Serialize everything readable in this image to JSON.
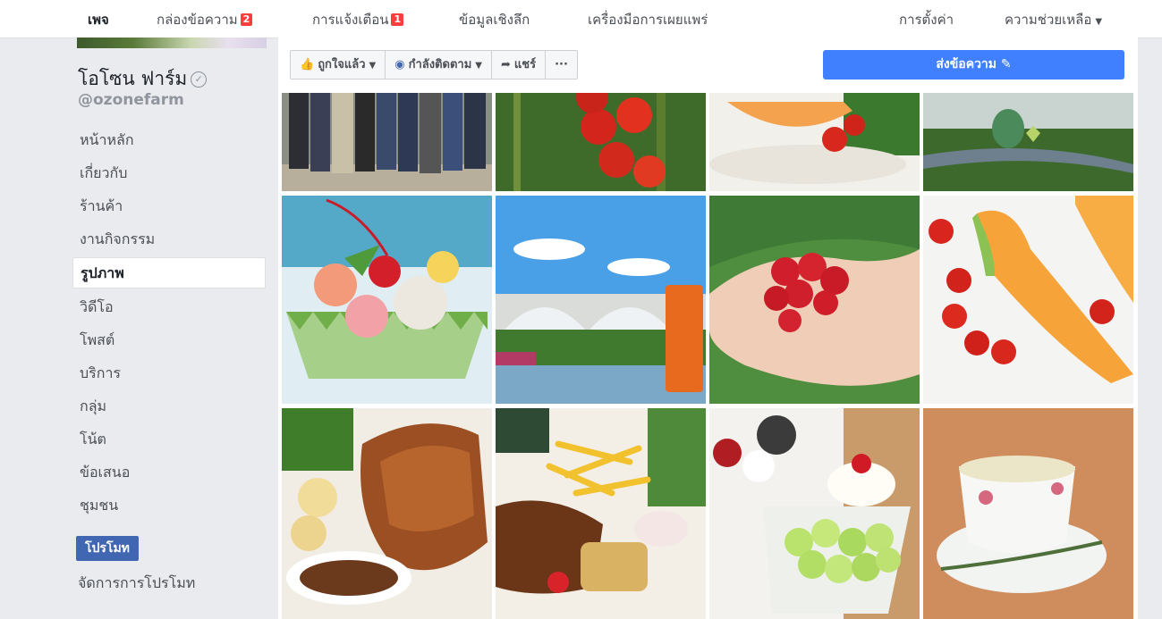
{
  "topnav": {
    "page_tab": "เพจ",
    "inbox_tab": "กล่องข้อความ",
    "inbox_count": "2",
    "notifications_tab": "การแจ้งเตือน",
    "notifications_count": "1",
    "insights_tab": "ข้อมูลเชิงลึก",
    "publishing_tools_tab": "เครื่องมือการเผยแพร่",
    "settings_tab": "การตั้งค่า",
    "help_tab": "ความช่วยเหลือ"
  },
  "page": {
    "name": "โอโซน ฟาร์ม",
    "handle": "@ozonefarm"
  },
  "sidebar": {
    "items": [
      {
        "label": "หน้าหลัก"
      },
      {
        "label": "เกี่ยวกับ"
      },
      {
        "label": "ร้านค้า"
      },
      {
        "label": "งานกิจกรรม"
      },
      {
        "label": "รูปภาพ",
        "selected": true
      },
      {
        "label": "วิดีโอ"
      },
      {
        "label": "โพสต์"
      },
      {
        "label": "บริการ"
      },
      {
        "label": "กลุ่ม"
      },
      {
        "label": "โน้ต"
      },
      {
        "label": "ข้อเสนอ"
      },
      {
        "label": "ชุมชน"
      }
    ],
    "promote_label": "โปรโมท",
    "manage_promotions_label": "จัดการการโปรโมท"
  },
  "actions": {
    "liked_label": "ถูกใจแล้ว",
    "following_label": "กำลังติดตาม",
    "share_label": "แชร์",
    "more_label": "···",
    "send_message_label": "ส่งข้อความ"
  },
  "photos": [
    {
      "subject": "group-of-people"
    },
    {
      "subject": "tomatoes-on-vine"
    },
    {
      "subject": "melon-and-tomato-plate"
    },
    {
      "subject": "garden-topiary"
    },
    {
      "subject": "fruit-salad-in-melon"
    },
    {
      "subject": "greenhouses-and-iced-tea"
    },
    {
      "subject": "strawberries-in-hands"
    },
    {
      "subject": "cantaloupe-slices-and-tomatoes"
    },
    {
      "subject": "crispy-pork-and-potato-salad"
    },
    {
      "subject": "steak-and-fries"
    },
    {
      "subject": "melon-ball-dessert"
    },
    {
      "subject": "tea-cup-with-rosemary"
    }
  ],
  "colors": {
    "brand_blue": "#4267b2",
    "send_button": "#4080ff",
    "badge_red": "#fa3e3e"
  }
}
